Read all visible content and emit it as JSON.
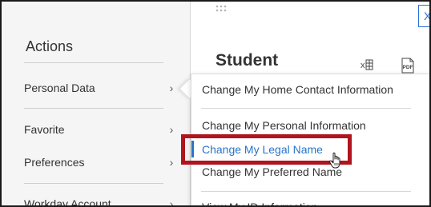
{
  "actions_panel": {
    "title": "Actions",
    "items": [
      {
        "label": "Personal Data",
        "chevron": "›"
      },
      {
        "label": "Favorite",
        "chevron": "›"
      },
      {
        "label": "Preferences",
        "chevron": "›"
      },
      {
        "label": "Workday Account",
        "chevron": "›"
      }
    ]
  },
  "header": {
    "title": "Student",
    "excel_icon": "excel-export-icon",
    "pdf_icon": "pdf-export-icon",
    "pdf_label": "PDF",
    "close_label": "X"
  },
  "popup_menu": {
    "items": [
      {
        "label": "Change My Home Contact Information"
      },
      {
        "label": "Change My Personal Information"
      },
      {
        "label": "Change My Legal Name"
      },
      {
        "label": "Change My Preferred Name"
      },
      {
        "label": "View My ID Information"
      }
    ]
  },
  "colors": {
    "link_active": "#2a74c9",
    "highlight": "#b0141e",
    "panel_bg": "#f5f5f5"
  }
}
